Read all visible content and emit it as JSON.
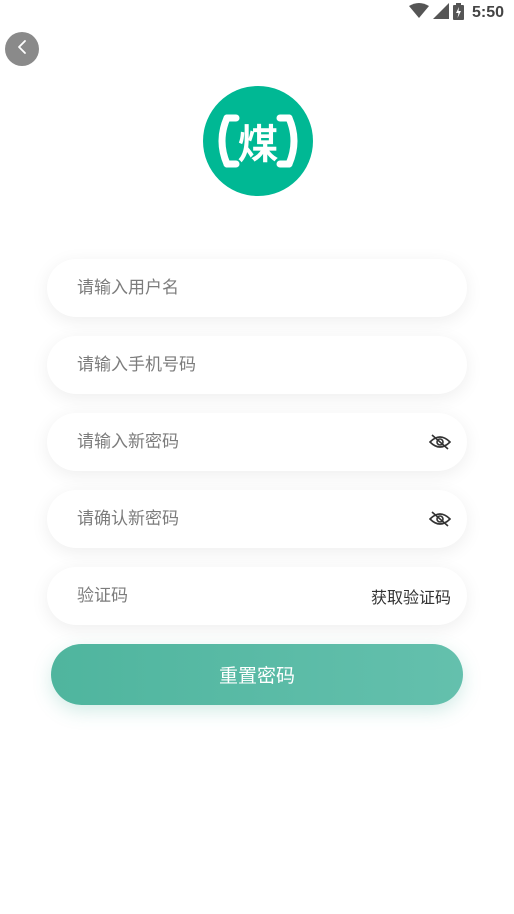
{
  "status_bar": {
    "time": "5:50",
    "icons": [
      "wifi-icon",
      "signal-icon",
      "battery-icon"
    ]
  },
  "header": {
    "back_icon": "chevron-left-icon"
  },
  "logo": {
    "char": "煤"
  },
  "form": {
    "username_placeholder": "请输入用户名",
    "phone_placeholder": "请输入手机号码",
    "new_password_placeholder": "请输入新密码",
    "confirm_password_placeholder": "请确认新密码",
    "code_placeholder": "验证码",
    "get_code_label": "获取验证码",
    "submit_label": "重置密码"
  },
  "colors": {
    "brand": "#00b894",
    "button": "#55b8a2",
    "back_button": "#8a8a8a"
  }
}
